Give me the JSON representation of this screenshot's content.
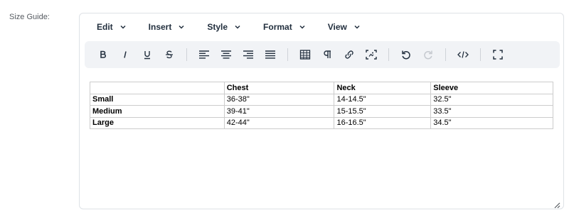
{
  "field": {
    "label": "Size Guide:"
  },
  "menubar": {
    "items": [
      {
        "label": "Edit"
      },
      {
        "label": "Insert"
      },
      {
        "label": "Style"
      },
      {
        "label": "Format"
      },
      {
        "label": "View"
      }
    ]
  },
  "toolbar": {
    "groups": [
      [
        "bold-icon",
        "italic-icon",
        "underline-icon",
        "strikethrough-icon"
      ],
      [
        "align-left-icon",
        "align-center-icon",
        "align-right-icon",
        "align-justify-icon"
      ],
      [
        "table-icon",
        "paragraph-mark-icon",
        "link-icon",
        "image-icon"
      ],
      [
        "undo-icon",
        "redo-icon"
      ],
      [
        "source-code-icon"
      ],
      [
        "fullscreen-icon"
      ]
    ],
    "disabled": [
      "redo-icon"
    ]
  },
  "table": {
    "headers": [
      "",
      "Chest",
      "Neck",
      "Sleeve"
    ],
    "rows": [
      [
        "Small",
        "36-38\"",
        "14-14.5\"",
        "32.5\""
      ],
      [
        "Medium",
        "39-41\"",
        "15-15.5\"",
        "33.5\""
      ],
      [
        "Large",
        "42-44\"",
        "16-16.5\"",
        "34.5\""
      ]
    ]
  },
  "colors": {
    "text": "#222f3e",
    "toolbar_bg": "#f1f3f6",
    "border": "#dee2e6",
    "disabled": "#c5c9cf"
  }
}
